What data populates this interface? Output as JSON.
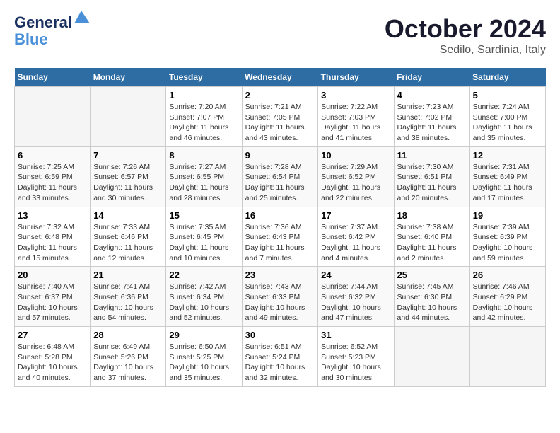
{
  "logo": {
    "line1": "General",
    "line2": "Blue"
  },
  "title": "October 2024",
  "subtitle": "Sedilo, Sardinia, Italy",
  "days_of_week": [
    "Sunday",
    "Monday",
    "Tuesday",
    "Wednesday",
    "Thursday",
    "Friday",
    "Saturday"
  ],
  "weeks": [
    [
      {
        "day": "",
        "sunrise": "",
        "sunset": "",
        "daylight": ""
      },
      {
        "day": "",
        "sunrise": "",
        "sunset": "",
        "daylight": ""
      },
      {
        "day": "1",
        "sunrise": "Sunrise: 7:20 AM",
        "sunset": "Sunset: 7:07 PM",
        "daylight": "Daylight: 11 hours and 46 minutes."
      },
      {
        "day": "2",
        "sunrise": "Sunrise: 7:21 AM",
        "sunset": "Sunset: 7:05 PM",
        "daylight": "Daylight: 11 hours and 43 minutes."
      },
      {
        "day": "3",
        "sunrise": "Sunrise: 7:22 AM",
        "sunset": "Sunset: 7:03 PM",
        "daylight": "Daylight: 11 hours and 41 minutes."
      },
      {
        "day": "4",
        "sunrise": "Sunrise: 7:23 AM",
        "sunset": "Sunset: 7:02 PM",
        "daylight": "Daylight: 11 hours and 38 minutes."
      },
      {
        "day": "5",
        "sunrise": "Sunrise: 7:24 AM",
        "sunset": "Sunset: 7:00 PM",
        "daylight": "Daylight: 11 hours and 35 minutes."
      }
    ],
    [
      {
        "day": "6",
        "sunrise": "Sunrise: 7:25 AM",
        "sunset": "Sunset: 6:59 PM",
        "daylight": "Daylight: 11 hours and 33 minutes."
      },
      {
        "day": "7",
        "sunrise": "Sunrise: 7:26 AM",
        "sunset": "Sunset: 6:57 PM",
        "daylight": "Daylight: 11 hours and 30 minutes."
      },
      {
        "day": "8",
        "sunrise": "Sunrise: 7:27 AM",
        "sunset": "Sunset: 6:55 PM",
        "daylight": "Daylight: 11 hours and 28 minutes."
      },
      {
        "day": "9",
        "sunrise": "Sunrise: 7:28 AM",
        "sunset": "Sunset: 6:54 PM",
        "daylight": "Daylight: 11 hours and 25 minutes."
      },
      {
        "day": "10",
        "sunrise": "Sunrise: 7:29 AM",
        "sunset": "Sunset: 6:52 PM",
        "daylight": "Daylight: 11 hours and 22 minutes."
      },
      {
        "day": "11",
        "sunrise": "Sunrise: 7:30 AM",
        "sunset": "Sunset: 6:51 PM",
        "daylight": "Daylight: 11 hours and 20 minutes."
      },
      {
        "day": "12",
        "sunrise": "Sunrise: 7:31 AM",
        "sunset": "Sunset: 6:49 PM",
        "daylight": "Daylight: 11 hours and 17 minutes."
      }
    ],
    [
      {
        "day": "13",
        "sunrise": "Sunrise: 7:32 AM",
        "sunset": "Sunset: 6:48 PM",
        "daylight": "Daylight: 11 hours and 15 minutes."
      },
      {
        "day": "14",
        "sunrise": "Sunrise: 7:33 AM",
        "sunset": "Sunset: 6:46 PM",
        "daylight": "Daylight: 11 hours and 12 minutes."
      },
      {
        "day": "15",
        "sunrise": "Sunrise: 7:35 AM",
        "sunset": "Sunset: 6:45 PM",
        "daylight": "Daylight: 11 hours and 10 minutes."
      },
      {
        "day": "16",
        "sunrise": "Sunrise: 7:36 AM",
        "sunset": "Sunset: 6:43 PM",
        "daylight": "Daylight: 11 hours and 7 minutes."
      },
      {
        "day": "17",
        "sunrise": "Sunrise: 7:37 AM",
        "sunset": "Sunset: 6:42 PM",
        "daylight": "Daylight: 11 hours and 4 minutes."
      },
      {
        "day": "18",
        "sunrise": "Sunrise: 7:38 AM",
        "sunset": "Sunset: 6:40 PM",
        "daylight": "Daylight: 11 hours and 2 minutes."
      },
      {
        "day": "19",
        "sunrise": "Sunrise: 7:39 AM",
        "sunset": "Sunset: 6:39 PM",
        "daylight": "Daylight: 10 hours and 59 minutes."
      }
    ],
    [
      {
        "day": "20",
        "sunrise": "Sunrise: 7:40 AM",
        "sunset": "Sunset: 6:37 PM",
        "daylight": "Daylight: 10 hours and 57 minutes."
      },
      {
        "day": "21",
        "sunrise": "Sunrise: 7:41 AM",
        "sunset": "Sunset: 6:36 PM",
        "daylight": "Daylight: 10 hours and 54 minutes."
      },
      {
        "day": "22",
        "sunrise": "Sunrise: 7:42 AM",
        "sunset": "Sunset: 6:34 PM",
        "daylight": "Daylight: 10 hours and 52 minutes."
      },
      {
        "day": "23",
        "sunrise": "Sunrise: 7:43 AM",
        "sunset": "Sunset: 6:33 PM",
        "daylight": "Daylight: 10 hours and 49 minutes."
      },
      {
        "day": "24",
        "sunrise": "Sunrise: 7:44 AM",
        "sunset": "Sunset: 6:32 PM",
        "daylight": "Daylight: 10 hours and 47 minutes."
      },
      {
        "day": "25",
        "sunrise": "Sunrise: 7:45 AM",
        "sunset": "Sunset: 6:30 PM",
        "daylight": "Daylight: 10 hours and 44 minutes."
      },
      {
        "day": "26",
        "sunrise": "Sunrise: 7:46 AM",
        "sunset": "Sunset: 6:29 PM",
        "daylight": "Daylight: 10 hours and 42 minutes."
      }
    ],
    [
      {
        "day": "27",
        "sunrise": "Sunrise: 6:48 AM",
        "sunset": "Sunset: 5:28 PM",
        "daylight": "Daylight: 10 hours and 40 minutes."
      },
      {
        "day": "28",
        "sunrise": "Sunrise: 6:49 AM",
        "sunset": "Sunset: 5:26 PM",
        "daylight": "Daylight: 10 hours and 37 minutes."
      },
      {
        "day": "29",
        "sunrise": "Sunrise: 6:50 AM",
        "sunset": "Sunset: 5:25 PM",
        "daylight": "Daylight: 10 hours and 35 minutes."
      },
      {
        "day": "30",
        "sunrise": "Sunrise: 6:51 AM",
        "sunset": "Sunset: 5:24 PM",
        "daylight": "Daylight: 10 hours and 32 minutes."
      },
      {
        "day": "31",
        "sunrise": "Sunrise: 6:52 AM",
        "sunset": "Sunset: 5:23 PM",
        "daylight": "Daylight: 10 hours and 30 minutes."
      },
      {
        "day": "",
        "sunrise": "",
        "sunset": "",
        "daylight": ""
      },
      {
        "day": "",
        "sunrise": "",
        "sunset": "",
        "daylight": ""
      }
    ]
  ]
}
